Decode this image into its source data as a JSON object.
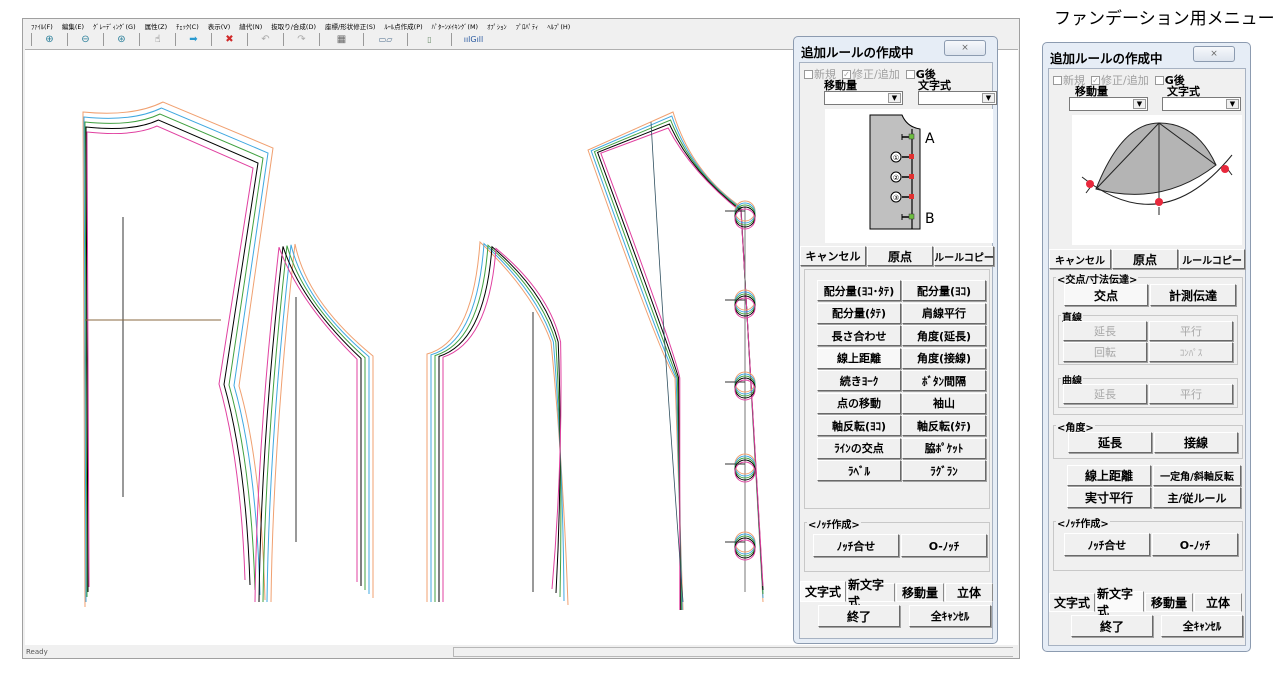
{
  "caption": "ファンデーション用メニュー",
  "app": {
    "menu": [
      "ﾌｧｲﾙ(F)",
      "編集(E)",
      "ｸﾞﾚｰﾃﾞｨﾝｸﾞ(G)",
      "属性(Z)",
      "ﾁｪｯｸ(C)",
      "表示(V)",
      "縫代(N)",
      "抜取り/合成(D)",
      "座標/形状修正(S)",
      "ﾙｰﾙ点作成(P)",
      "ﾊﾟﾀｰﾝﾒｲｷﾝｸﾞ(M)",
      "ｵﾌﾟｼｮﾝ",
      "ﾌﾟﾛﾊﾟﾃｨ",
      "ﾍﾙﾌﾟ(H)"
    ],
    "toolbar": [
      {
        "name": "zoom-in-icon",
        "glyph": "⊕"
      },
      {
        "name": "zoom-out-icon",
        "glyph": "⊖"
      },
      {
        "name": "zoom-fit-icon",
        "glyph": "⊛"
      },
      {
        "name": "pointer-icon",
        "glyph": "☝"
      },
      {
        "name": "next-arrow-icon",
        "glyph": "➡"
      },
      {
        "name": "stop-arrow-icon",
        "glyph": "✖"
      },
      {
        "name": "undo-icon",
        "glyph": "↶"
      },
      {
        "name": "redo-icon",
        "glyph": "↷"
      },
      {
        "name": "piece-info-icon",
        "glyph": "▦"
      },
      {
        "name": "piece-layout-icon",
        "glyph": "▭▱"
      },
      {
        "name": "document-icon",
        "glyph": "▯"
      },
      {
        "name": "grade-chart-icon",
        "glyph": "ıılGıll"
      }
    ],
    "status": "Ready",
    "line_colors": {
      "base": "#000000",
      "size1": "#e040a0",
      "size2": "#40a040",
      "size3": "#40a8e0",
      "size4": "#f0a070"
    }
  },
  "dialog_left": {
    "title": "追加ルールの作成中",
    "close": "⨯",
    "checks": [
      {
        "label": "新規",
        "checked": false,
        "disabled": true
      },
      {
        "label": "修正/追加",
        "checked": true,
        "disabled": true
      },
      {
        "label": "G後",
        "checked": false,
        "disabled": false
      }
    ],
    "move_label": "移動量",
    "formula_label": "文字式",
    "move_value": "",
    "formula_value": "",
    "preview_labels": {
      "a": "A",
      "b": "B",
      "n1": "①",
      "n2": "②",
      "n3": "③"
    },
    "top_buttons": [
      "キャンセル",
      "原点",
      "ルールコピー"
    ],
    "grid_buttons": [
      [
        "配分量(ﾖｺ･ﾀﾃ)",
        "配分量(ﾖｺ)"
      ],
      [
        "配分量(ﾀﾃ)",
        "肩線平行"
      ],
      [
        "長さ合わせ",
        "角度(延長)"
      ],
      [
        "線上距離",
        "角度(接線)"
      ],
      [
        "続きﾖｰｸ",
        "ﾎﾞﾀﾝ間隔"
      ],
      [
        "点の移動",
        "袖山"
      ],
      [
        "軸反転(ﾖｺ)",
        "軸反転(ﾀﾃ)"
      ],
      [
        "ﾗｲﾝの交点",
        "脇ﾎﾟｹｯﾄ"
      ],
      [
        "ﾗﾍﾞﾙ",
        "ﾗｸﾞﾗﾝ"
      ]
    ],
    "notch_group": "<ﾉｯﾁ作成>",
    "notch_buttons": [
      "ﾉｯﾁ合せ",
      "O-ﾉｯﾁ"
    ],
    "tabs": [
      "文字式",
      "新文字式",
      "移動量",
      "立体"
    ],
    "selected_tab": 0,
    "bottom_buttons": [
      "終了",
      "全ｷｬﾝｾﾙ"
    ]
  },
  "dialog_right": {
    "title": "追加ルールの作成中",
    "close": "⨯",
    "checks": [
      {
        "label": "新規",
        "checked": false,
        "disabled": true
      },
      {
        "label": "修正/追加",
        "checked": true,
        "disabled": true
      },
      {
        "label": "G後",
        "checked": false,
        "disabled": false
      }
    ],
    "move_label": "移動量",
    "formula_label": "文字式",
    "move_value": "",
    "formula_value": "",
    "top_buttons": [
      "キャンセル",
      "原点",
      "ルールコピー"
    ],
    "intersect_group": "<交点/寸法伝達>",
    "intersect_buttons": [
      "交点",
      "計測伝達"
    ],
    "straight_group": "直線",
    "straight_buttons": [
      "延長",
      "平行",
      "回転",
      "ｺﾝﾊﾟｽ"
    ],
    "curve_group": "曲線",
    "curve_buttons": [
      "延長",
      "平行"
    ],
    "angle_group": "<角度>",
    "angle_buttons": [
      "延長",
      "接線"
    ],
    "misc_buttons": [
      "線上距離",
      "一定角/斜軸反転",
      "実寸平行",
      "主/従ルール"
    ],
    "notch_group": "<ﾉｯﾁ作成>",
    "notch_buttons": [
      "ﾉｯﾁ合せ",
      "O-ﾉｯﾁ"
    ],
    "tabs": [
      "文字式",
      "新文字式",
      "移動量",
      "立体"
    ],
    "selected_tab": 1,
    "bottom_buttons": [
      "終了",
      "全ｷｬﾝｾﾙ"
    ]
  }
}
